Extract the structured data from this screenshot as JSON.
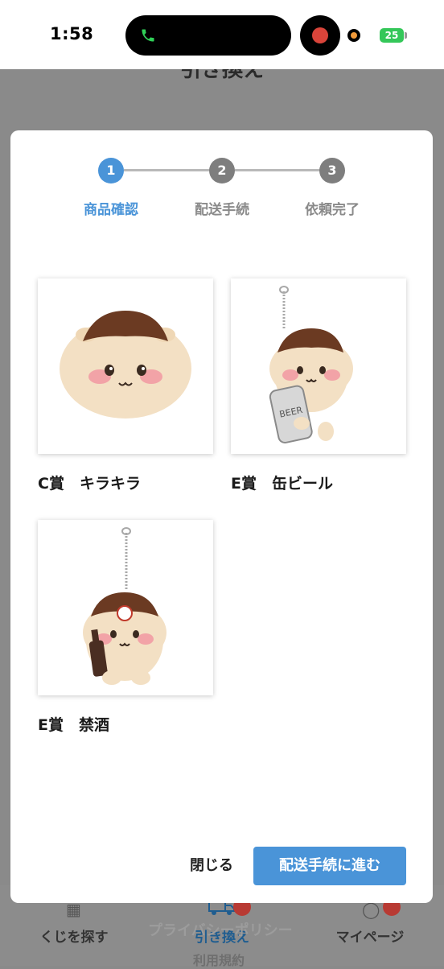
{
  "status_bar": {
    "time": "1:58",
    "battery": "25"
  },
  "background": {
    "page_title": "引き換え",
    "overlap_text": "プライバシーポリシー",
    "bottom_text": "利用規約",
    "nav": [
      {
        "label": "くじを探す"
      },
      {
        "label": "引き換え"
      },
      {
        "label": "マイページ"
      }
    ]
  },
  "modal": {
    "steps": [
      {
        "number": "1",
        "label": "商品確認"
      },
      {
        "number": "2",
        "label": "配送手続"
      },
      {
        "number": "3",
        "label": "依頼完了"
      }
    ],
    "prizes": [
      {
        "name": "C賞　キラキラ"
      },
      {
        "name": "E賞　缶ビール"
      },
      {
        "name": "E賞　禁酒"
      }
    ],
    "close_label": "閉じる",
    "next_label": "配送手続に進む"
  },
  "colors": {
    "accent": "#4a94d8",
    "badge": "#b83a33",
    "battery": "#34c759"
  }
}
